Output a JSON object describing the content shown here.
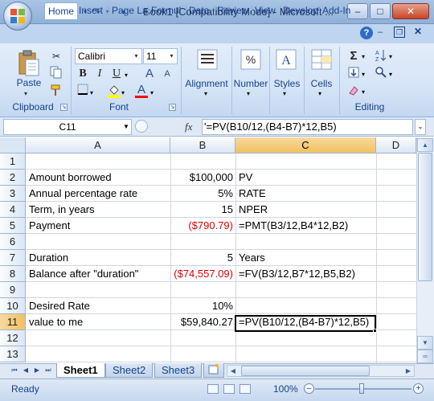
{
  "window": {
    "title": "Book1  [Compatibility Mode] - Microsoft ...",
    "minimize": "–",
    "maximize": "□",
    "close": "✕"
  },
  "quick_access": {
    "save_icon": "save-icon",
    "undo_icon": "undo-icon",
    "redo_icon": "redo-icon"
  },
  "tabs": [
    "Home",
    "Insert",
    "Page La",
    "Formul",
    "Data",
    "Review",
    "View",
    "Develop",
    "Add-In"
  ],
  "ribbon": {
    "clipboard": {
      "label": "Clipboard",
      "paste": "Paste"
    },
    "font": {
      "label": "Font",
      "font_name": "Calibri",
      "font_size": "11",
      "bold": "B",
      "italic": "I",
      "underline": "U",
      "grow": "A",
      "shrink": "A"
    },
    "alignment": {
      "label": "Alignment"
    },
    "number": {
      "label": "Number"
    },
    "styles": {
      "label": "Styles"
    },
    "cells": {
      "label": "Cells"
    },
    "editing": {
      "label": "Editing"
    }
  },
  "formula_bar": {
    "name_box": "C11",
    "fx": "fx",
    "formula": "'=PV(B10/12,(B4-B7)*12,B5)"
  },
  "grid": {
    "columns": [
      "A",
      "B",
      "C",
      "D"
    ],
    "rows": [
      "1",
      "2",
      "3",
      "4",
      "5",
      "6",
      "7",
      "8",
      "9",
      "10",
      "11",
      "12",
      "13"
    ],
    "cells": {
      "A2": "Amount borrowed",
      "B2": "$100,000",
      "C2": "PV",
      "A3": "Annual percentage rate",
      "B3": "5%",
      "C3": "RATE",
      "A4": "Term, in years",
      "B4": "15",
      "C4": "NPER",
      "A5": "Payment",
      "B5": "($790.79)",
      "C5": "=PMT(B3/12,B4*12,B2)",
      "A7": "Duration",
      "B7": "5",
      "C7": "Years",
      "A8": "Balance after \"duration\"",
      "B8": "($74,557.09)",
      "C8": "=FV(B3/12,B7*12,B5,B2)",
      "A10": "Desired Rate",
      "B10": "10%",
      "A11": "value to me",
      "B11": "$59,840.27",
      "C11": "=PV(B10/12,(B4-B7)*12,B5)"
    },
    "selected_cell": "C11",
    "negative_color": "#e00000"
  },
  "sheets": [
    "Sheet1",
    "Sheet2",
    "Sheet3"
  ],
  "active_sheet": "Sheet1",
  "status": {
    "text": "Ready",
    "zoom": "100%"
  }
}
